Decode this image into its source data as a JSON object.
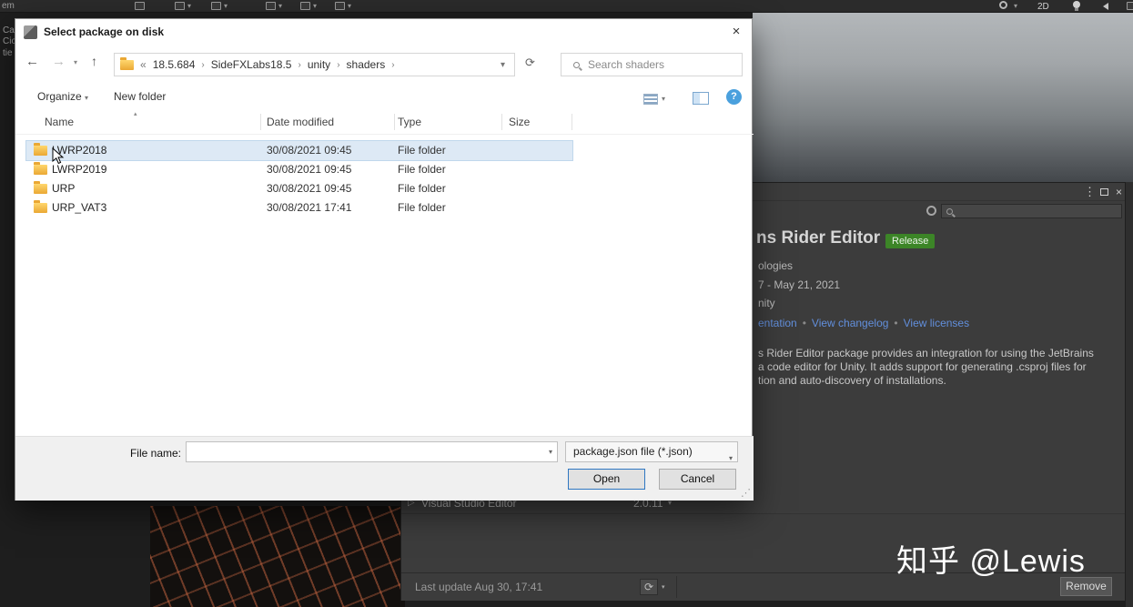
{
  "unity": {
    "top_left_fragments": [
      "em",
      "Ca",
      "Cio",
      "tie"
    ],
    "toolbar_2d": "2D"
  },
  "icons": {
    "back": "←",
    "forward": "→",
    "up": "↑",
    "caret": "▾",
    "refresh": "⟳",
    "close": "×",
    "kebab": "⋮",
    "sort": "▴",
    "breadcrumb_prefix": "«",
    "crumb_sep": "›",
    "link_sep": "•",
    "expand": "▷",
    "help": "?",
    "grip": "⋰"
  },
  "dialog": {
    "title": "Select package on disk",
    "breadcrumb_items": [
      "18.5.684",
      "SideFXLabs18.5",
      "unity",
      "shaders"
    ],
    "search_placeholder": "Search shaders",
    "organize_label": "Organize",
    "new_folder_label": "New folder",
    "columns": {
      "name": "Name",
      "date": "Date modified",
      "type": "Type",
      "size": "Size"
    },
    "files": [
      {
        "name": "LWRP2018",
        "date": "30/08/2021 09:45",
        "type": "File folder",
        "size": ""
      },
      {
        "name": "LWRP2019",
        "date": "30/08/2021 09:45",
        "type": "File folder",
        "size": ""
      },
      {
        "name": "URP",
        "date": "30/08/2021 09:45",
        "type": "File folder",
        "size": ""
      },
      {
        "name": "URP_VAT3",
        "date": "30/08/2021 17:41",
        "type": "File folder",
        "size": ""
      }
    ],
    "file_name_label": "File name:",
    "file_name_value": "",
    "file_type_filter": "package.json file (*.json)",
    "open_label": "Open",
    "cancel_label": "Cancel"
  },
  "package_manager": {
    "title_partial": "ns Rider Editor",
    "status_badge": "Release",
    "author_partial": "ologies",
    "version_partial": "7 - May 21, 2021",
    "registry_partial": "nity",
    "links": [
      "entation",
      "View changelog",
      "View licenses"
    ],
    "description_lines": [
      "s Rider Editor package provides an integration for using the JetBrains",
      "a code editor for Unity. It adds support for generating .csproj files for",
      "tion and auto-discovery of installations."
    ],
    "list_item_name": "Visual Studio Editor",
    "list_item_version": "2.0.11",
    "last_update": "Last update Aug 30, 17:41",
    "remove_label": "Remove"
  },
  "watermark": "知乎 @Lewis"
}
